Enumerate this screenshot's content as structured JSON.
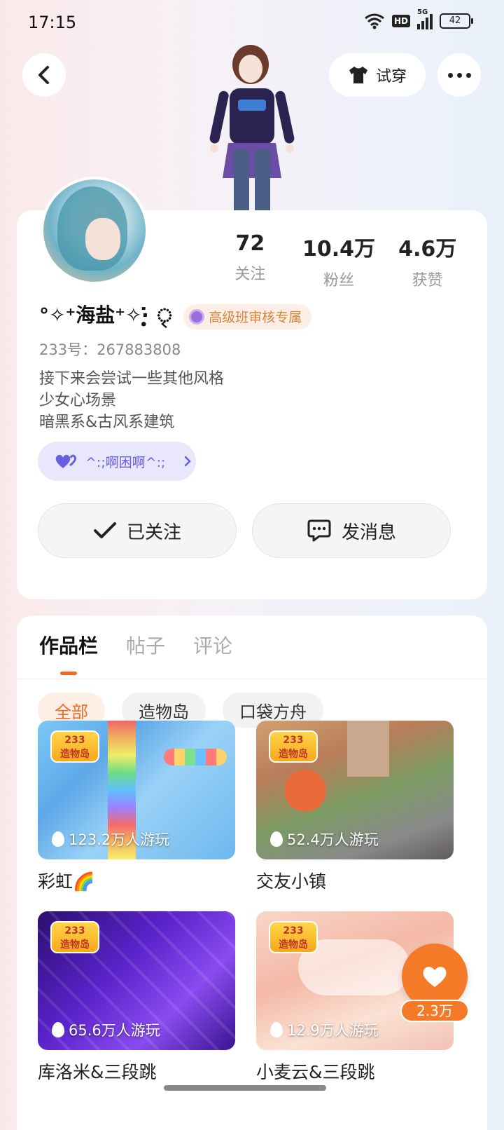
{
  "status_bar": {
    "time": "17:15",
    "hd": "HD",
    "network": "5G",
    "battery": "42"
  },
  "header": {
    "tryon_label": "试穿"
  },
  "profile": {
    "stats": [
      {
        "value": "72",
        "label": "关注"
      },
      {
        "value": "10.4万",
        "label": "粉丝"
      },
      {
        "value": "4.6万",
        "label": "获赞"
      }
    ],
    "username": "°✧⁺海盐⁺✧‧̣̥̇ ৃ",
    "badge": "高级班审核专属",
    "uid": "233号：267883808",
    "bio": [
      "接下来会尝试一些其他风格",
      "少女心场景",
      "暗黑系&古风系建筑"
    ],
    "group": "^:;啊困啊^:;",
    "follow_label": "已关注",
    "message_label": "发消息"
  },
  "works": {
    "tabs": [
      "作品栏",
      "帖子",
      "评论"
    ],
    "chips": [
      "全部",
      "造物岛",
      "口袋方舟"
    ],
    "badge_text": [
      "233",
      "造物岛"
    ],
    "games": [
      {
        "title": "彩虹🌈",
        "plays": "123.2万人游玩"
      },
      {
        "title": "交友小镇",
        "plays": "52.4万人游玩"
      },
      {
        "title": "库洛米&三段跳",
        "plays": "65.6万人游玩"
      },
      {
        "title": "小麦云&三段跳",
        "plays": "12.9万人游玩"
      }
    ]
  },
  "like": {
    "count": "2.3万"
  },
  "colors": {
    "accent": "#f57a27",
    "tab_indicator": "#f26a22",
    "vip_text": "#d9833a",
    "group_text": "#6a5ee0"
  }
}
